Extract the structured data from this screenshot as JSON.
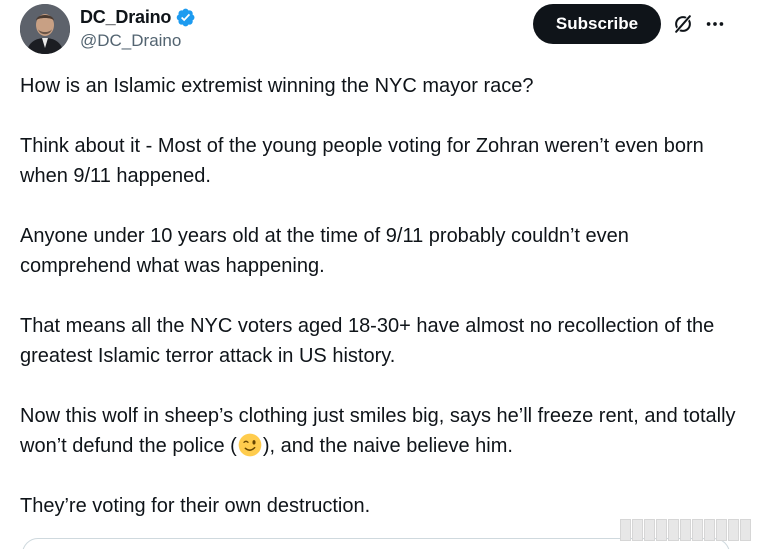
{
  "header": {
    "display_name": "DC_Draino",
    "handle": "@DC_Draino",
    "subscribe_label": "Subscribe",
    "verified": true,
    "accent_color": "#1d9bf0"
  },
  "icons": {
    "verified": "verified-badge-icon",
    "grok": "grok-icon",
    "more": "more-horizontal-icon",
    "emoji": "winking-face-emoji"
  },
  "tweet": {
    "paragraphs": [
      "How is an Islamic extremist winning the NYC mayor race?",
      "Think about it - Most of the young people voting for Zohran weren’t even born when 9/11 happened.",
      "Anyone under 10 years old at the time of 9/11 probably couldn’t even comprehend what was happening.",
      "That means all the NYC voters aged 18-30+ have almost no recollection of the greatest Islamic terror attack in US history.",
      {
        "before_emoji": "Now this wolf in sheep’s clothing just smiles big, says he’ll freeze rent, and totally won’t defund the police (",
        "after_emoji": "), and the naive believe him."
      },
      "They’re voting for their own destruction."
    ]
  }
}
